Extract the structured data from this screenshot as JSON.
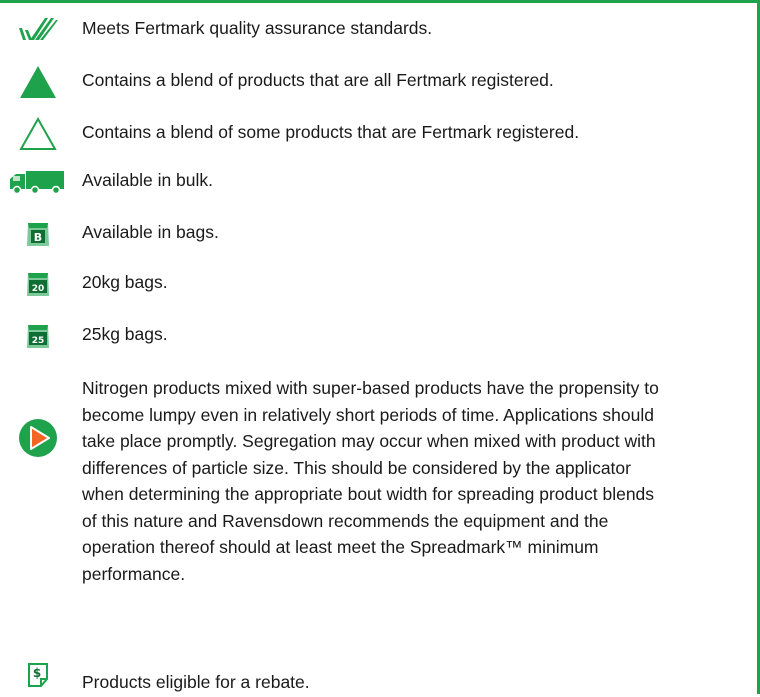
{
  "legend": {
    "fertmark": "Meets Fertmark quality assurance standards.",
    "all_registered": "Contains a blend of products that are all Fertmark registered.",
    "some_registered": "Contains a blend of some products that are Fertmark registered.",
    "bulk": "Available in bulk.",
    "bags": "Available in bags.",
    "bags20": "20kg bags.",
    "bags25": "25kg bags.",
    "bag_b_label": "B",
    "bag_20_label": "20",
    "bag_25_label": "25",
    "rebate_label": "$",
    "rebate": "Products eligible for a rebate."
  },
  "note": {
    "lines": [
      "Nitrogen products mixed with super-based products have the propensity to",
      "become lumpy even in relatively short periods of time. Applications should",
      "take place promptly. Segregation may occur when mixed with product with",
      "differences of particle size. This should be considered by the applicator",
      "when determining the appropriate bout width for spreading product blends",
      "of this nature and Ravensdown recommends the equipment and the",
      "operation thereof should at least meet the Spreadmark™ minimum",
      "performance."
    ]
  },
  "colors": {
    "green": "#1fa24c",
    "orange": "#f26522"
  }
}
